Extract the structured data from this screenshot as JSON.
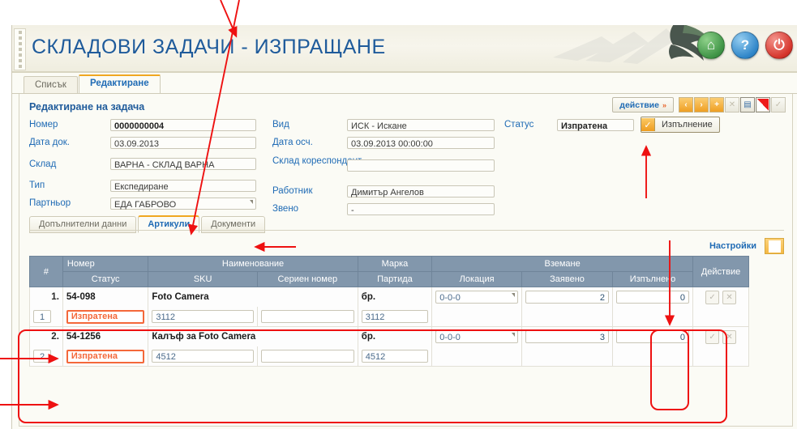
{
  "app": {
    "title": "СКЛАДОВИ ЗАДАЧИ - ИЗПРАЩАНЕ",
    "header_icons": [
      {
        "name": "home-icon",
        "glyph": "⌂",
        "color": "#3f9446"
      },
      {
        "name": "help-icon",
        "glyph": "?",
        "color": "#2f86c9"
      },
      {
        "name": "power-icon",
        "glyph": "⏻",
        "color": "#d6352c"
      }
    ]
  },
  "tabs": [
    {
      "label": "Списък",
      "active": false
    },
    {
      "label": "Редактиране",
      "active": true
    }
  ],
  "panel": {
    "title": "Редактиране на задача",
    "action_button": "действие",
    "action_arrow": "»",
    "nav_buttons": [
      {
        "name": "prev-button",
        "glyph": "‹",
        "style": "orange"
      },
      {
        "name": "next-button",
        "glyph": "›",
        "style": "orange"
      },
      {
        "name": "add-button",
        "glyph": "+",
        "style": "orange"
      },
      {
        "name": "delete-button",
        "glyph": "✕",
        "style": "disabled"
      },
      {
        "name": "save-button",
        "glyph": "▤",
        "style": "white"
      },
      {
        "name": "cancel-button",
        "glyph": "",
        "style": "red"
      },
      {
        "name": "confirm-button",
        "glyph": "✓",
        "style": "disabled"
      }
    ]
  },
  "form": {
    "left": [
      {
        "label": "Номер",
        "value": "0000000004",
        "bold": true,
        "dropdown": false
      },
      {
        "label": "Дата док.",
        "value": "03.09.2013",
        "bold": false,
        "dropdown": false
      },
      {
        "label": "Склад",
        "value": "ВАРНА - СКЛАД ВАРНА",
        "bold": false,
        "dropdown": false
      },
      {
        "label": "Тип",
        "value": "Експедиране",
        "bold": false,
        "dropdown": false
      },
      {
        "label": "Партньор",
        "value": "ЕДА ГАБРОВО",
        "bold": false,
        "dropdown": true
      }
    ],
    "right": [
      {
        "label": "Вид",
        "value": "ИСК - Искане",
        "dropdown": false
      },
      {
        "label": "Дата осч.",
        "value": "03.09.2013 00:00:00",
        "dropdown": false
      },
      {
        "label": "Склад кореспондент",
        "value": "",
        "dropdown": false
      },
      {
        "label": "Работник",
        "value": "Димитър Ангелов",
        "dropdown": false
      },
      {
        "label": "Звено",
        "value": "-",
        "dropdown": false
      }
    ],
    "status": {
      "label": "Статус",
      "value": "Изпратена",
      "execute_button": "Изпълнение",
      "execute_check": "✓"
    }
  },
  "inner_tabs": [
    {
      "label": "Допълнителни данни",
      "active": false
    },
    {
      "label": "Артикули",
      "active": true
    },
    {
      "label": "Документи",
      "active": false
    }
  ],
  "settings": {
    "label": "Настройки",
    "icon": "settings-square-icon"
  },
  "grid": {
    "header_row1": [
      "#",
      "Номер",
      "Наименование",
      "Марка",
      "Вземане",
      "Действие"
    ],
    "header_row2": [
      "Статус",
      "SKU",
      "Сериен номер",
      "Партида",
      "Локация",
      "Заявено",
      "Изпълнено"
    ],
    "group_header": "Вземане",
    "action_header": "Действие",
    "rows": [
      {
        "index": "1.",
        "index_input": "1",
        "number": "54-098",
        "name": "Foto Camera",
        "brand": "бр.",
        "status": "Изпратена",
        "sku": "3112",
        "serial": "",
        "batch": "3112",
        "location": "0-0-0",
        "requested": "2",
        "executed": "0",
        "actions": [
          "✓",
          "✕"
        ]
      },
      {
        "index": "2.",
        "index_input": "2",
        "number": "54-1256",
        "name": "Калъф за Foto Camera",
        "brand": "бр.",
        "status": "Изпратена",
        "sku": "4512",
        "serial": "",
        "batch": "4512",
        "location": "0-0-0",
        "requested": "3",
        "executed": "0",
        "actions": [
          "✓",
          "✕"
        ]
      }
    ]
  },
  "colors": {
    "accent_blue": "#1f6bb5",
    "title_blue": "#1f5b9b",
    "orange": "#f0a720",
    "status_orange": "#f4683a",
    "grid_header": "#8297ac",
    "annotation_red": "#ee1111"
  }
}
